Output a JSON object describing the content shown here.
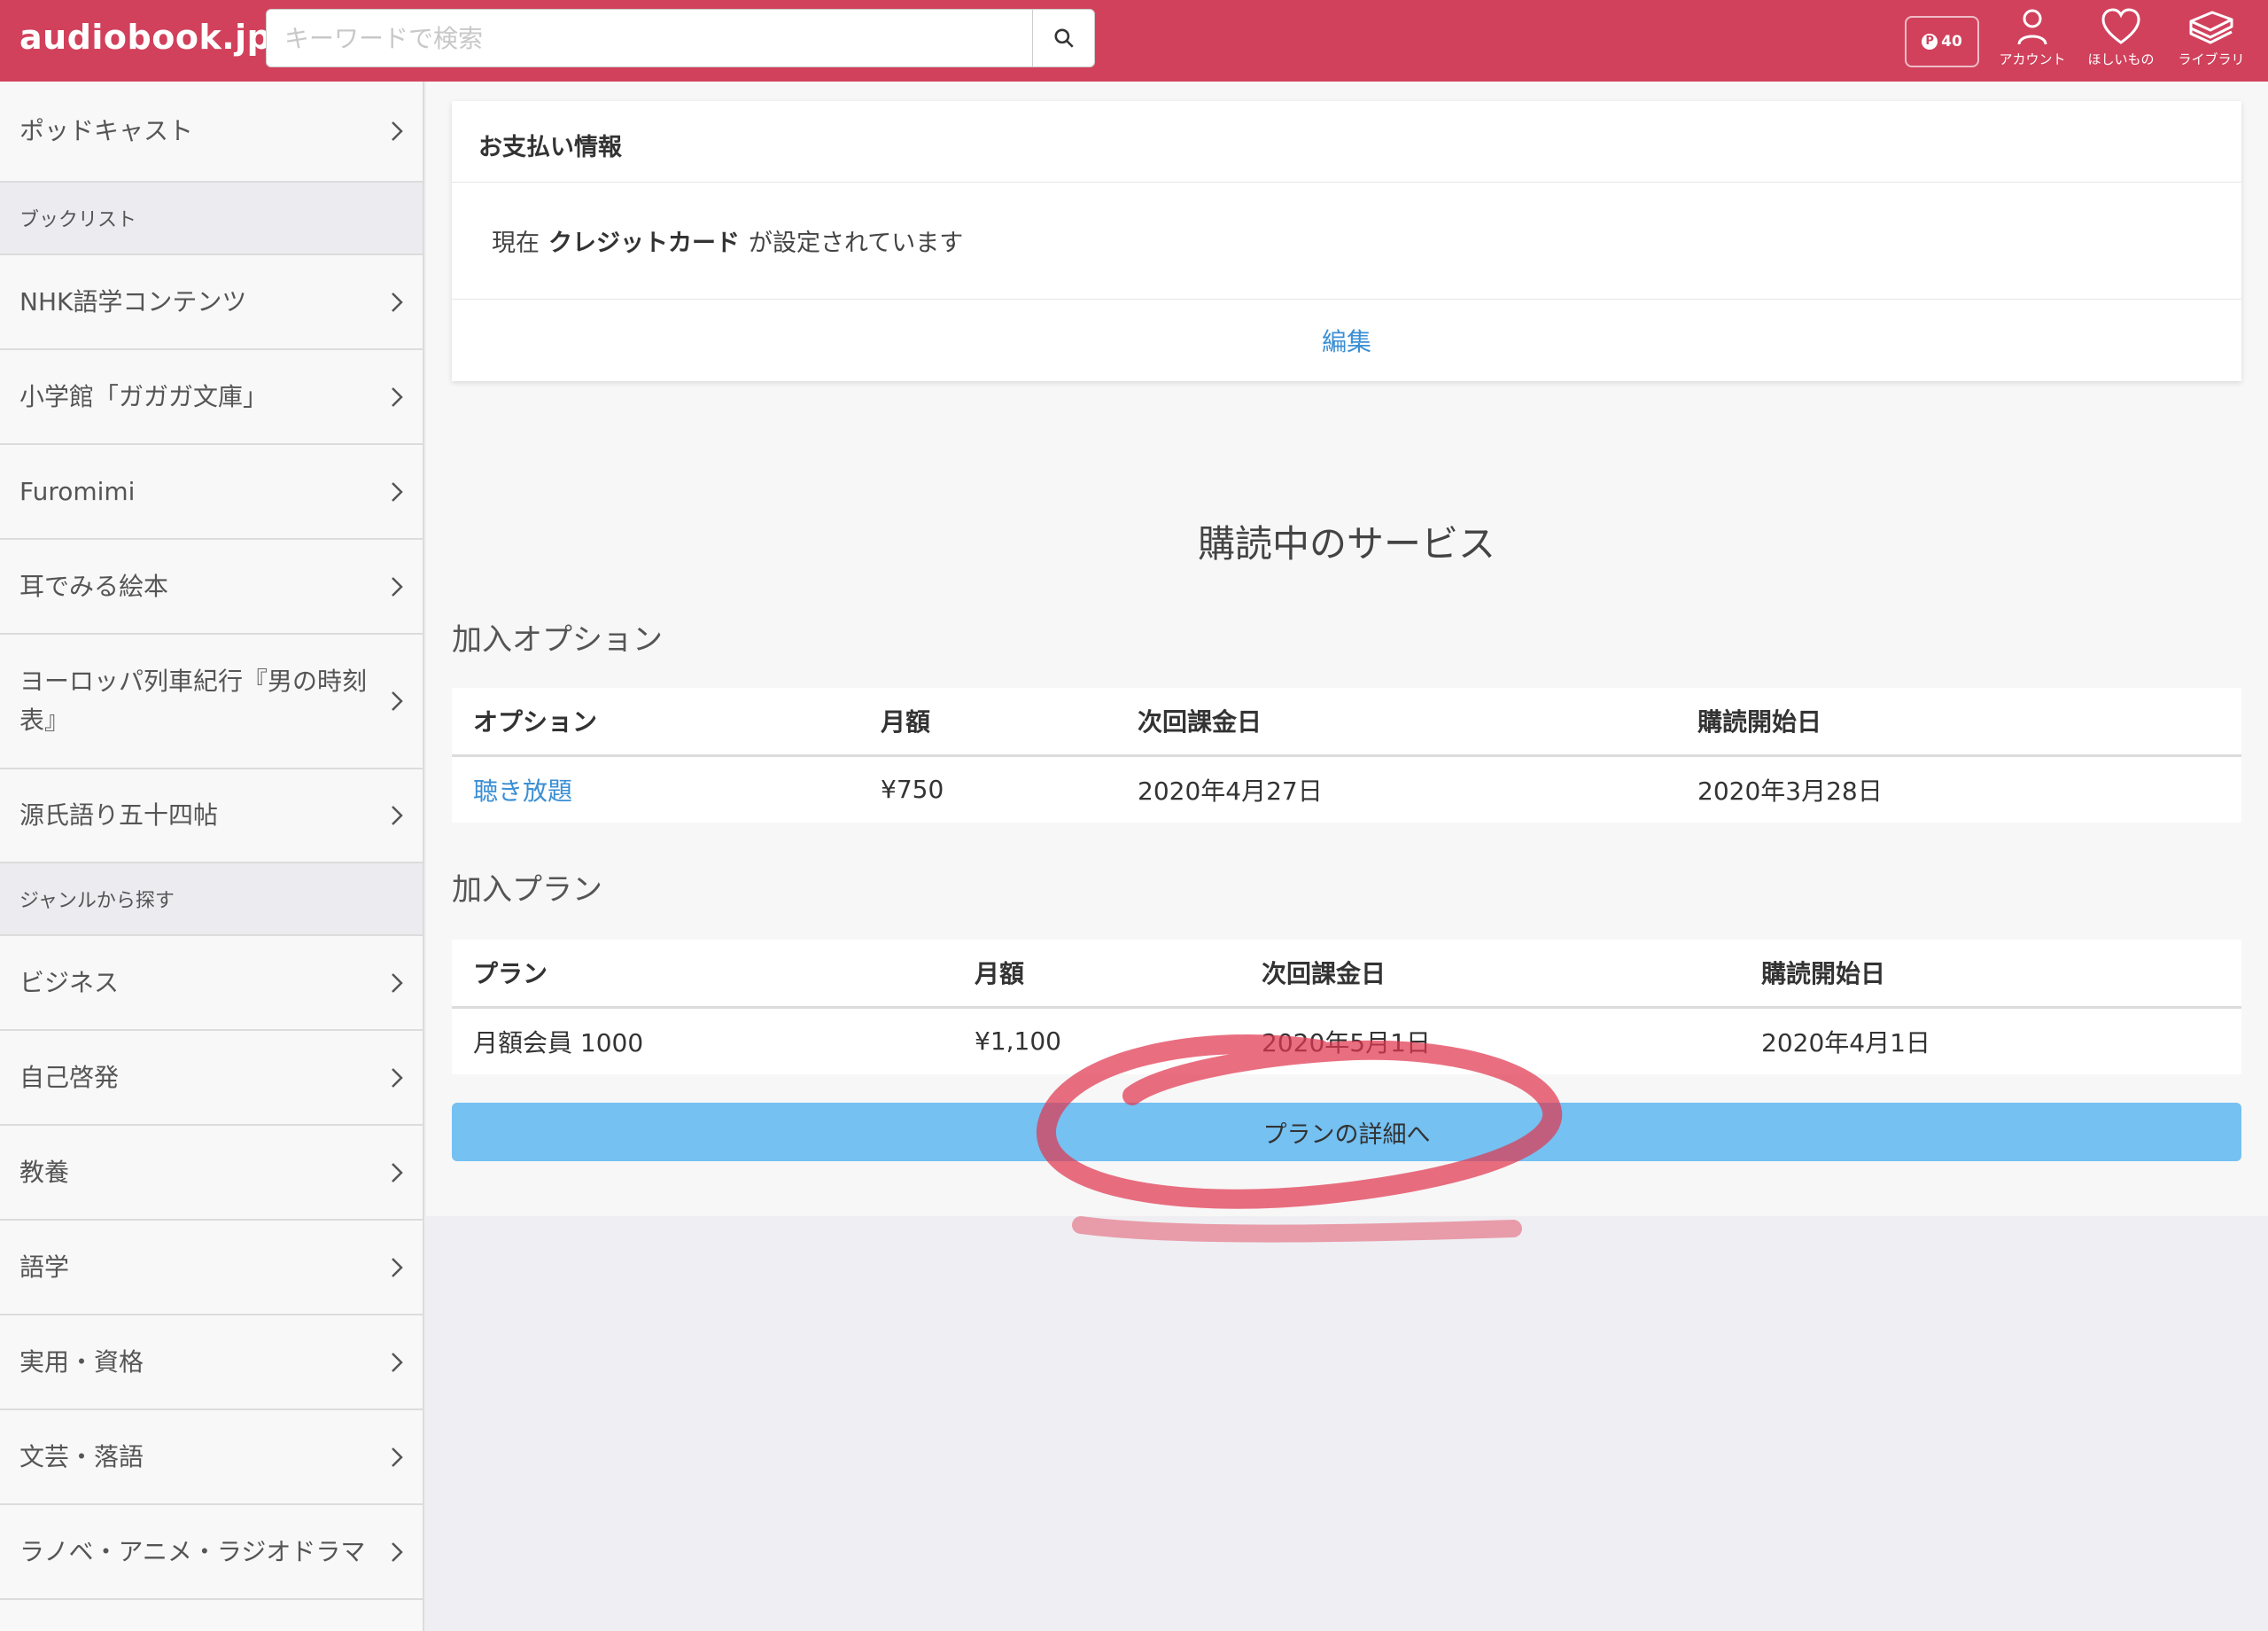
{
  "header": {
    "logo": "audiobook.jp",
    "search_placeholder": "キーワードで検索",
    "points": "40",
    "icons": {
      "account": "アカウント",
      "wishlist": "ほしいもの",
      "library": "ライブラリ"
    },
    "colors": {
      "brand": "#d1415c"
    }
  },
  "sidebar": {
    "top_item": "ポッドキャスト",
    "section_booklist": "ブックリスト",
    "booklist_items": [
      "NHK語学コンテンツ",
      "小学館「ガガガ文庫」",
      "Furomimi",
      "耳でみる絵本",
      "ヨーロッパ列車紀行『男の時刻表』",
      "源氏語り五十四帖"
    ],
    "section_genre": "ジャンルから探す",
    "genre_items": [
      "ビジネス",
      "自己啓発",
      "教養",
      "語学",
      "実用・資格",
      "文芸・落語",
      "ラノベ・アニメ・ラジオドラマ"
    ]
  },
  "payment": {
    "title": "お支払い情報",
    "prefix": "現在",
    "method": "クレジットカード",
    "suffix": "が設定されています",
    "edit": "編集"
  },
  "subscriptions": {
    "title": "購読中のサービス",
    "options": {
      "title": "加入オプション",
      "headers": [
        "オプション",
        "月額",
        "次回課金日",
        "購読開始日"
      ],
      "rows": [
        [
          "聴き放題",
          "¥750",
          "2020年4月27日",
          "2020年3月28日"
        ]
      ]
    },
    "plans": {
      "title": "加入プラン",
      "headers": [
        "プラン",
        "月額",
        "次回課金日",
        "購読開始日"
      ],
      "rows": [
        [
          "月額会員 1000",
          "¥1,100",
          "2020年5月1日",
          "2020年4月1日"
        ]
      ]
    },
    "detail_button": "プランの詳細へ"
  }
}
